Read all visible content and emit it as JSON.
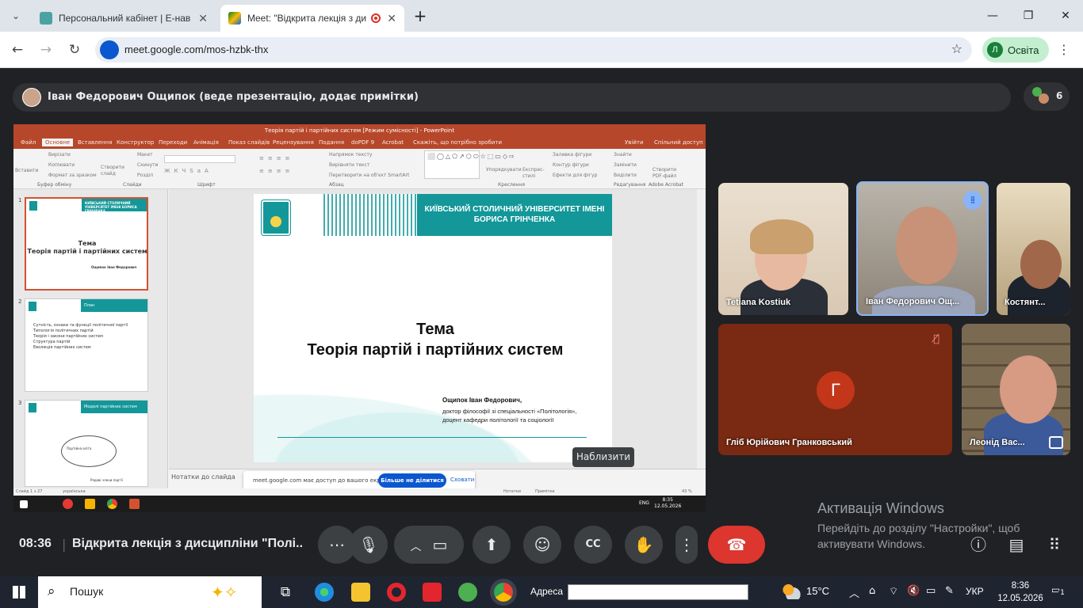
{
  "browser": {
    "tabs": [
      {
        "title": "Персональний кабінет | Е-нав",
        "active": false
      },
      {
        "title": "Meet: \"Відкрита лекція з ди",
        "active": true
      }
    ],
    "new_tab": "+",
    "url": "meet.google.com/mos-hzbk-thx",
    "profile_initial": "Л",
    "profile_name": "Освіта"
  },
  "meet": {
    "presenter_banner": "Іван Федорович Ощипок (веде презентацію, додає примітки)",
    "participant_count": "6",
    "tooltip": "Наблизити",
    "tiles": [
      {
        "name": "Tetiana Kostiuk"
      },
      {
        "name": "Іван Федорович Ощ..."
      },
      {
        "name": "Костянт..."
      },
      {
        "name": "Гліб Юрійович Гранковський",
        "avatar_letter": "Г"
      },
      {
        "name": "Леонід Вас..."
      }
    ],
    "time": "08:36",
    "separator": "|",
    "meeting_title": "Відкрита лекція з дисципліни \"Полі..."
  },
  "powerpoint": {
    "window_title": "Теорія партій і партійних систем [Режим сумісності] - PowerPoint",
    "tabs": [
      "Файл",
      "Основне",
      "Вставлення",
      "Конструктор",
      "Переходи",
      "Анімація",
      "Показ слайдів",
      "Рецензування",
      "Подання",
      "doPDF 9",
      "Acrobat",
      "Скажіть, що потрібно зробити"
    ],
    "share_links": [
      "Увійти",
      "Спільний доступ"
    ],
    "ribbon_groups": [
      "Буфер обміну",
      "Слайди",
      "Шрифт",
      "Абзац",
      "Креслення",
      "Редагування",
      "Adobe Acrobat"
    ],
    "ribbon_items": [
      "Вставити",
      "Вирізати",
      "Копіювати",
      "Формат за зразком",
      "Створити слайд",
      "Макет",
      "Скинути",
      "Розділ",
      "Напрямок тексту",
      "Вирівняти текст",
      "Перетворити на об'єкт SmartArt",
      "Упорядкувати",
      "Експрес-стилі",
      "Заливка фігури",
      "Контур фігури",
      "Ефекти для фігур",
      "Знайти",
      "Замінити",
      "Виділити",
      "Створити PDF-файл"
    ],
    "thumbnails": [
      {
        "num": "1",
        "band": "КИЇВСЬКИЙ СТОЛИЧНИЙ УНІВЕРСИТЕТ ІМЕНІ БОРИСА ГРІНЧЕНКА",
        "title": "Тема",
        "subtitle": "Теорія партій і партійних систем",
        "author": "Ощипок Іван Федорович"
      },
      {
        "num": "2",
        "band": "План",
        "items": [
          "Сутність, ознаки та функції політичної партії",
          "Типологія політичних партій",
          "Теорія і закони партійних систем",
          "Структура партій",
          "Еволюція партійних систем"
        ]
      },
      {
        "num": "3",
        "band": "Моделі партійних систем",
        "inner": [
          "Партійна еліта",
          "Рядові члени партії"
        ]
      }
    ],
    "slide": {
      "university": "КИЇВСЬКИЙ СТОЛИЧНИЙ УНІВЕРСИТЕТ ІМЕНІ БОРИСА ГРІНЧЕНКА",
      "heading": "Тема",
      "topic": "Теорія партій і партійних систем",
      "author": "Ощипок Іван Федорович,",
      "degree_line1": "доктор філософії зі спеціальності «Політологія»,",
      "degree_line2": "доцент кафедри політології та соціології"
    },
    "notes_placeholder": "Нотатки до слайда",
    "status_left": "Слайд 1 з 27",
    "status_lang": "українська",
    "status_notes": "Нотатки",
    "status_comments": "Примітки",
    "zoom": "43 %",
    "share_notice": "meet.google.com має доступ до вашого екрана.",
    "share_stop": "Більше не ділитися",
    "share_hide": "Сховати",
    "inner_clock_time": "8:35",
    "inner_clock_date": "12.05.2026",
    "inner_lang": "ENG"
  },
  "windows": {
    "activation_title": "Активація Windows",
    "activation_text": "Перейдіть до розділу \"Настройки\", щоб активувати Windows.",
    "search_placeholder": "Пошук",
    "address_label": "Адреса",
    "temperature": "15°C",
    "language": "УКР",
    "clock_time": "8:36",
    "clock_date": "12.05.2026",
    "notifications": "1"
  },
  "colors": {
    "ppt_accent": "#b7472a",
    "slide_teal": "#139799",
    "meet_bg": "#202124",
    "hangup_red": "#dc362e",
    "share_blue": "#0b57d0"
  }
}
